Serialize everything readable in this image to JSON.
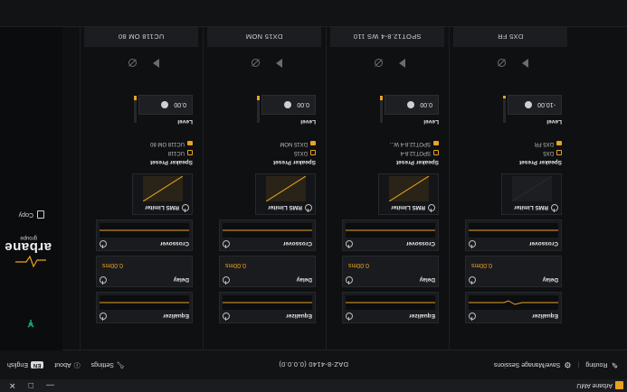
{
  "window": {
    "title": "Arbane AMU",
    "min": "—",
    "max": "□",
    "close": "✕"
  },
  "topbar": {
    "routing_label": "Routing",
    "sessions_label": "Save/Manage Sessions",
    "device_name": "DAZ-8-4140 (0.0.0.0)",
    "settings_label": "Settings",
    "about_label": "About",
    "language_badge": "EN",
    "language_label": "English"
  },
  "side": {
    "copy_label": "Copy",
    "brand": "arbane",
    "brand_sub": "groupe"
  },
  "modules": {
    "equalizer": "Equalizer",
    "delay": "Delay",
    "crossover": "Crossover",
    "limiter": "RMS Limiter",
    "preset": "Speaker Preset",
    "level": "Level"
  },
  "channels": [
    {
      "name": "DX5 FR",
      "delay": "0.00ms",
      "level": "-10.00",
      "preset_line1": "DX5",
      "preset_line2": "DX5 FR"
    },
    {
      "name": "SPOT12.8-4 WS 110",
      "delay": "0.00ms",
      "level": "0.00",
      "preset_line1": "SPOT12.8-4",
      "preset_line2": "SPOT12.8-4 W..."
    },
    {
      "name": "DX15 NOM",
      "delay": "0.00ms",
      "level": "0.00",
      "preset_line1": "DX15",
      "preset_line2": "DX15 NOM"
    },
    {
      "name": "UC118 OM 80",
      "delay": "0.00ms",
      "level": "0.00",
      "preset_line1": "UC118",
      "preset_line2": "UC118 OM 80"
    }
  ],
  "colors": {
    "accent": "#e8a320",
    "background": "#0f1012",
    "panel": "#1a1b1e",
    "brand_green": "#1aa36a"
  }
}
